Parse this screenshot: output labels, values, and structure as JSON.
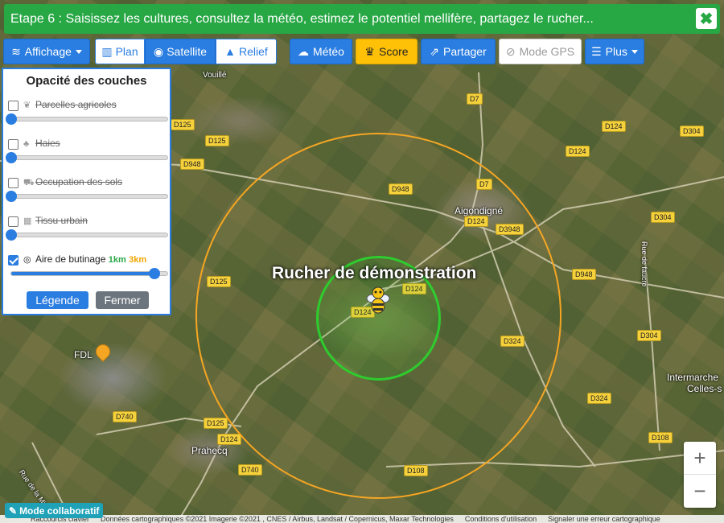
{
  "banner": {
    "text": "Etape 6 : Saisissez les cultures, consultez la météo, estimez le potentiel mellifère, partagez le rucher...",
    "close_glyph": "✖"
  },
  "toolbar": {
    "affichage": "Affichage",
    "plan": "Plan",
    "satellite": "Satellite",
    "relief": "Relief",
    "meteo": "Météo",
    "score": "Score",
    "partager": "Partager",
    "gps": "Mode GPS",
    "plus": "Plus"
  },
  "panel": {
    "title": "Opacité des couches",
    "layers": [
      {
        "label": "Parcelles agricoles",
        "checked": false,
        "value": 0,
        "icon": "leaf-icon"
      },
      {
        "label": "Haies",
        "checked": false,
        "value": 0,
        "icon": "tree-icon"
      },
      {
        "label": "Occupation des sols",
        "checked": false,
        "value": 0,
        "icon": "tractor-icon"
      },
      {
        "label": "Tissu urbain",
        "checked": false,
        "value": 0,
        "icon": "industry-icon"
      },
      {
        "label": "Aire de butinage",
        "checked": true,
        "value": 0.92,
        "icon": "target-icon",
        "km1": "1km",
        "km3": "3km"
      }
    ],
    "legend_button": "Légende",
    "close_button": "Fermer"
  },
  "map": {
    "rucher_label": "Rucher de démonstration",
    "places": [
      "Aigondigné",
      "FDL",
      "Prahecq",
      "Intermarche",
      "Celles-s",
      "Rue de la Mirange",
      "Rue de faucré",
      "Vouillé"
    ],
    "roads": [
      "D7",
      "D7",
      "D125",
      "D125",
      "D125",
      "D125",
      "D948",
      "D948",
      "D948",
      "D124",
      "D124",
      "D124",
      "D124",
      "D124",
      "D124",
      "D3948",
      "D324",
      "D324",
      "D304",
      "D304",
      "D304",
      "D740",
      "D740",
      "D108",
      "D108"
    ],
    "colors": {
      "inner_circle": "#2ecc2e",
      "outer_circle": "#f5a623"
    }
  },
  "zoom": {
    "in": "+",
    "out": "−"
  },
  "collab": "Mode collaboratif",
  "attribution": {
    "shortcuts": "Raccourcis clavier",
    "data": "Données cartographiques ©2021 Imagerie ©2021 , CNES / Airbus, Landsat / Copernicus, Maxar Technologies",
    "terms": "Conditions d'utilisation",
    "report": "Signaler une erreur cartographique"
  }
}
